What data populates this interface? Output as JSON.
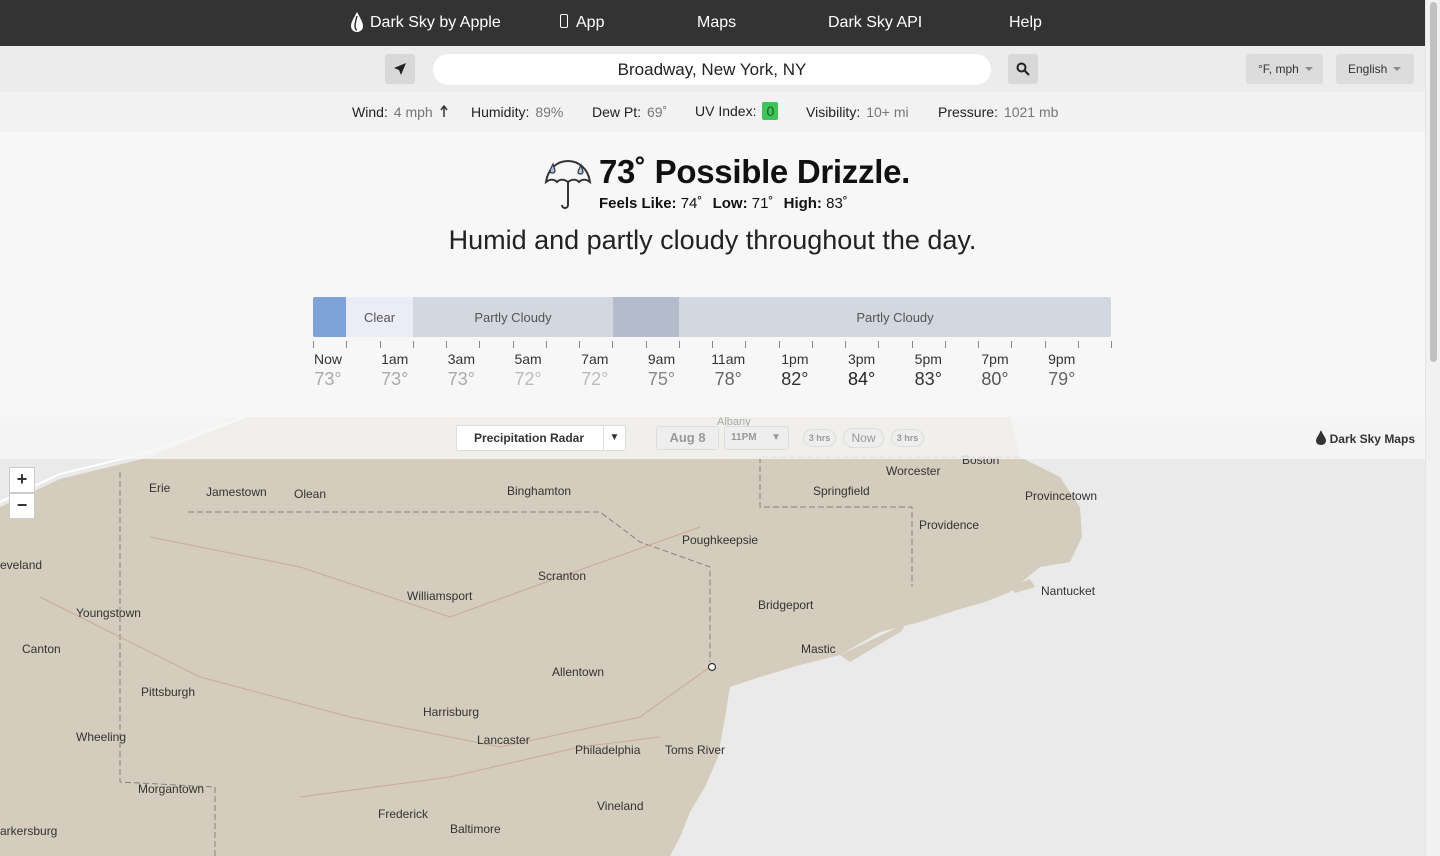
{
  "nav": {
    "brand": "Dark Sky by Apple",
    "app": "App",
    "maps": "Maps",
    "api": "Dark Sky API",
    "help": "Help"
  },
  "search": {
    "value": "Broadway, New York, NY",
    "units": "°F, mph",
    "language": "English"
  },
  "conditions": {
    "wind_label": "Wind:",
    "wind_value": "4 mph",
    "humidity_label": "Humidity:",
    "humidity_value": "89%",
    "dew_label": "Dew Pt:",
    "dew_value": "69˚",
    "uv_label": "UV Index:",
    "uv_value": "0",
    "visibility_label": "Visibility:",
    "visibility_value": "10+ mi",
    "pressure_label": "Pressure:",
    "pressure_value": "1021 mb",
    "uv_color": "#3ec457"
  },
  "current": {
    "headline": "73˚ Possible Drizzle.",
    "feels_label": "Feels Like:",
    "feels_value": "74˚",
    "low_label": "Low:",
    "low_value": "71˚",
    "high_label": "High:",
    "high_value": "83˚",
    "day_summary": "Humid and partly cloudy throughout the day."
  },
  "timeline": {
    "segments": [
      {
        "label": "",
        "color": "#7fa2d9"
      },
      {
        "label": "Clear",
        "color": "#ececf7"
      },
      {
        "label": "Partly Cloudy",
        "color": "#d3d7e0"
      },
      {
        "label": "",
        "color": "#b4bccc"
      },
      {
        "label": "Partly Cloudy",
        "color": "#d3d7e0"
      }
    ],
    "hours": [
      {
        "hour": "Now",
        "temp": "73°",
        "color": "#aaaaaa"
      },
      {
        "hour": "1am",
        "temp": "73°",
        "color": "#aaaaaa"
      },
      {
        "hour": "3am",
        "temp": "73°",
        "color": "#aaaaaa"
      },
      {
        "hour": "5am",
        "temp": "72°",
        "color": "#bbbbbb"
      },
      {
        "hour": "7am",
        "temp": "72°",
        "color": "#bbbbbb"
      },
      {
        "hour": "9am",
        "temp": "75°",
        "color": "#888888"
      },
      {
        "hour": "11am",
        "temp": "78°",
        "color": "#666666"
      },
      {
        "hour": "1pm",
        "temp": "82°",
        "color": "#333333"
      },
      {
        "hour": "3pm",
        "temp": "84°",
        "color": "#222222"
      },
      {
        "hour": "5pm",
        "temp": "83°",
        "color": "#333333"
      },
      {
        "hour": "7pm",
        "temp": "80°",
        "color": "#555555"
      },
      {
        "hour": "9pm",
        "temp": "79°",
        "color": "#666666"
      }
    ]
  },
  "map": {
    "layer": "Precipitation Radar",
    "date": "Aug 8",
    "time": "11PM",
    "back": "3 hrs",
    "now": "Now",
    "forward": "3 hrs",
    "brand": "Dark Sky Maps",
    "zoom_in": "+",
    "zoom_out": "−",
    "cities": [
      "Boston",
      "Worcester",
      "Springfield",
      "Provincetown",
      "Providence",
      "Nantucket",
      "Erie",
      "Jamestown",
      "Olean",
      "Binghamton",
      "Poughkeepsie",
      "eveland",
      "Scranton",
      "Williamsport",
      "Youngstown",
      "Bridgeport",
      "Canton",
      "Mastic",
      "Allentown",
      "Pittsburgh",
      "Harrisburg",
      "Lancaster",
      "Wheeling",
      "Philadelphia",
      "Toms River",
      "Morgantown",
      "Vineland",
      "Frederick",
      "Baltimore",
      "arkersburg",
      "Albany"
    ]
  }
}
